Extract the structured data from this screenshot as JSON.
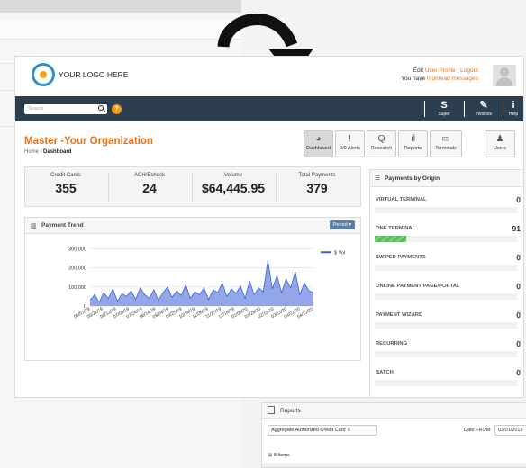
{
  "header": {
    "logo_text": "YOUR LOGO HERE",
    "edit_prefix": "Edit",
    "user_profile_link": "User Profile",
    "separator": "|",
    "logout_link": "Logout",
    "unread_prefix": "You have",
    "unread_link": "0 unread messages"
  },
  "navbar": {
    "search_placeholder": "Search",
    "help_badge": "?",
    "buttons": [
      {
        "label": "Super",
        "icon": "S"
      },
      {
        "label": "Invoices",
        "icon": "✎"
      },
      {
        "label": "Help",
        "icon": "i"
      }
    ]
  },
  "page": {
    "title": "Master -Your Organization",
    "breadcrumb_home": "Home",
    "breadcrumb_sep": "/",
    "breadcrumb_current": "Dashboard"
  },
  "toolbar": [
    {
      "label": "Dashboard",
      "icon": "speedometer-icon",
      "glyph": "◕"
    },
    {
      "label": "0/0 Alerts",
      "icon": "alert-icon",
      "glyph": "!"
    },
    {
      "label": "Research",
      "icon": "search-icon",
      "glyph": "Q"
    },
    {
      "label": "Reports",
      "icon": "bar-chart-icon",
      "glyph": "ıl"
    },
    {
      "label": "Terminals",
      "icon": "terminal-icon",
      "glyph": "▭"
    },
    {
      "label": "Users",
      "icon": "user-icon",
      "glyph": "♟"
    }
  ],
  "stats": [
    {
      "label": "Credit Cards",
      "value": "355"
    },
    {
      "label": "ACH/Echeck",
      "value": "24"
    },
    {
      "label": "Volume",
      "value": "$64,445.95"
    },
    {
      "label": "Total Payments",
      "value": "379"
    }
  ],
  "payment_trend": {
    "title": "Payment Trend",
    "period_button": "Period ▾"
  },
  "chart_data": {
    "type": "area",
    "series_color": "#3b5fd6",
    "yticks": [
      "0",
      "100,000",
      "200,000",
      "300,000"
    ],
    "ylim": [
      0,
      320000
    ],
    "xticks": [
      "05/01/19",
      "05/22/19",
      "06/12/19",
      "07/03/19",
      "07/24/19",
      "08/14/19",
      "09/04/19",
      "09/25/19",
      "10/16/19",
      "11/06/19",
      "11/27/19",
      "12/18/19",
      "01/08/20",
      "01/29/20",
      "02/19/20",
      "03/11/20",
      "04/01/20",
      "04/22/20"
    ],
    "series": [
      {
        "name": "$ Vol",
        "values": [
          30000,
          60000,
          20000,
          70000,
          40000,
          90000,
          25000,
          65000,
          50000,
          80000,
          35000,
          95000,
          60000,
          40000,
          85000,
          30000,
          70000,
          100000,
          45000,
          80000,
          55000,
          110000,
          40000,
          75000,
          60000,
          95000,
          35000,
          85000,
          70000,
          120000,
          50000,
          90000,
          65000,
          105000,
          40000,
          130000,
          60000,
          95000,
          75000,
          240000,
          90000,
          160000,
          70000,
          140000,
          95000,
          180000,
          60000,
          120000,
          80000,
          70000
        ]
      }
    ],
    "legend": "right"
  },
  "origin": {
    "title": "Payments by Origin",
    "rows": [
      {
        "name": "VIRTUAL TERMINAL",
        "value": "0",
        "fill": 0
      },
      {
        "name": "ONE TERMINAL",
        "value": "91",
        "fill": 0.22
      },
      {
        "name": "SWIPED PAYMENTS",
        "value": "0",
        "fill": 0
      },
      {
        "name": "ONLINE PAYMENT PAGE/PORTAL",
        "value": "0",
        "fill": 0
      },
      {
        "name": "PAYMENT WIZARD",
        "value": "0",
        "fill": 0
      },
      {
        "name": "RECURRING",
        "value": "0",
        "fill": 0
      },
      {
        "name": "BATCH",
        "value": "0",
        "fill": 0
      }
    ]
  },
  "reports": {
    "title": "Reports",
    "select_value": "Aggregate Authorized Credit Card ⇕",
    "date_from_label": "Date FROM:",
    "date_from_value": "03/01/2019",
    "items_count": "8 Items"
  }
}
